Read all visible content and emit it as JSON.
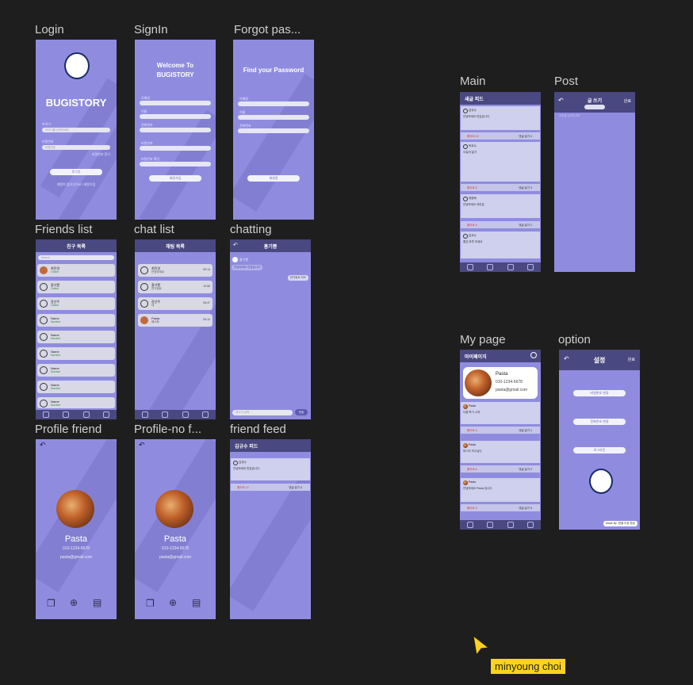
{
  "frames": {
    "login": {
      "label": "Login",
      "brand": "BUGISTORY",
      "id_label": "아이디",
      "id_ph": "아이디를 입력하세요",
      "pw_label": "비밀번호",
      "pw_ph": "비밀번호",
      "forgot": "비밀번호 찾기",
      "login_btn": "로그인",
      "signup_hint": "계정이 없으신가요? 회원가입"
    },
    "signin": {
      "label": "SignIn",
      "title1": "Welcome To",
      "title2": "BUGISTORY",
      "f1": "이메일",
      "f2": "이름",
      "f3": "전화번호",
      "f4": "비밀번호",
      "f5": "비밀번호 확인",
      "btn": "회원가입"
    },
    "forgot": {
      "label": "Forgot pas...",
      "title": "Find your Password",
      "f1": "이메일",
      "f2": "이름",
      "f3": "전화번호",
      "btn": "재설정"
    },
    "friends": {
      "label": "Friends list",
      "header": "친구 목록",
      "search": "Search",
      "items": [
        {
          "name": "최민영",
          "status": "Online"
        },
        {
          "name": "홍기쁨",
          "status": "Online"
        },
        {
          "name": "장선주",
          "status": "Online"
        },
        {
          "name": "Name",
          "status": "Number"
        },
        {
          "name": "Name",
          "status": "Number"
        },
        {
          "name": "Name",
          "status": "Number"
        },
        {
          "name": "Name",
          "status": "Number"
        },
        {
          "name": "Name",
          "status": "Number"
        },
        {
          "name": "Name",
          "status": "Number"
        }
      ]
    },
    "chatlist": {
      "label": "chat list",
      "header": "채팅 목록",
      "items": [
        {
          "name": "최민영",
          "msg": "안녕하세요",
          "time": "09:14"
        },
        {
          "name": "홍기쁨",
          "msg": "반가워요",
          "time": "10:58"
        },
        {
          "name": "장선주",
          "msg": "네",
          "time": "08:47"
        },
        {
          "name": "Pasta",
          "msg": "배고파",
          "time": "09:14"
        }
      ]
    },
    "chatting": {
      "label": "chatting",
      "header": "홍기쁨",
      "peer": "홍기쁨",
      "in_msg": "안녕하세요 반갑습니다",
      "out_msg": "반가워요 저도",
      "input_ph": "메시지 입력",
      "send": "전송"
    },
    "profile_friend": {
      "label": "Profile friend",
      "name": "Pasta",
      "phone": "010-1234-5678",
      "email": "pasta@gmail.com"
    },
    "profile_nof": {
      "label": "Profile-no f...",
      "name": "Pasta",
      "phone": "010-1234-5678",
      "email": "pasta@gmail.com"
    },
    "friend_feed": {
      "label": "friend feed",
      "header": "김규수 피드",
      "author": "김규수",
      "body": "안녕하세요 반갑습니다",
      "likes": "좋아요 12",
      "comments": "댓글 달기 4"
    },
    "main": {
      "label": "Main",
      "header": "새글 피드",
      "posts": [
        {
          "author": "김규수",
          "body": "안녕하세요 반갑습니다",
          "likes": "좋아요 12",
          "comments": "댓글 달기 4"
        },
        {
          "author": "박교수",
          "body": "오늘의 일기",
          "likes": "좋아요 8",
          "comments": "댓글 달기 3"
        },
        {
          "author": "최윤희",
          "body": "안녕하세요 여러분",
          "likes": "좋아요 5",
          "comments": "댓글 달기 2"
        },
        {
          "author": "김교수",
          "body": "좋은 하루 되세요",
          "likes": "",
          "comments": ""
        }
      ]
    },
    "post": {
      "label": "Post",
      "header": "글 쓰기",
      "done": "완료",
      "placeholder": "내용을 입력하세요"
    },
    "mypage": {
      "label": "My page",
      "header": "마이페이지",
      "name": "Pasta",
      "phone": "010-1234-5678",
      "email": "pasta@gmail.com",
      "posts": [
        {
          "author": "Pasta",
          "body": "다음 학기 시작",
          "likes": "좋아요 3",
          "comments": "댓글 달기 1"
        },
        {
          "author": "Pasta",
          "body": "파스타 먹고싶다",
          "likes": "좋아요 6",
          "comments": "댓글 달기 2"
        },
        {
          "author": "Pasta",
          "body": "안녕하세요 Pasta 입니다",
          "likes": "좋아요 9",
          "comments": "댓글 달기 5"
        }
      ]
    },
    "option": {
      "label": "option",
      "header": "설정",
      "done": "완료",
      "b1": "비밀번호 변경",
      "b2": "전화번호 변경",
      "b3": "로그아웃",
      "credit": "Made By: 한별 이정 한송"
    }
  },
  "cursor_user": "minyoung choi"
}
